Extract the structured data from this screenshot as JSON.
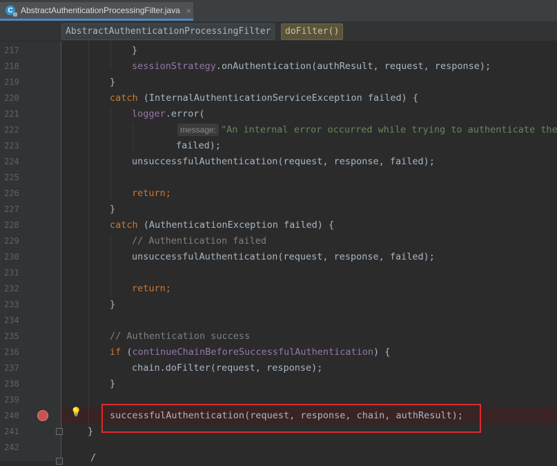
{
  "tab": {
    "label": "AbstractAuthenticationProcessingFilter.java",
    "close": "×",
    "icon": "java-class-icon"
  },
  "breadcrumb": {
    "class_name": "AbstractAuthenticationProcessingFilter",
    "method_name": "doFilter()"
  },
  "lines": [
    {
      "num": "217"
    },
    {
      "num": "218"
    },
    {
      "num": "219"
    },
    {
      "num": "220"
    },
    {
      "num": "221"
    },
    {
      "num": "222"
    },
    {
      "num": "223"
    },
    {
      "num": "224"
    },
    {
      "num": "225"
    },
    {
      "num": "226"
    },
    {
      "num": "227"
    },
    {
      "num": "228"
    },
    {
      "num": "229"
    },
    {
      "num": "230"
    },
    {
      "num": "231"
    },
    {
      "num": "232"
    },
    {
      "num": "233"
    },
    {
      "num": "234"
    },
    {
      "num": "235"
    },
    {
      "num": "236"
    },
    {
      "num": "237"
    },
    {
      "num": "238"
    },
    {
      "num": "239"
    },
    {
      "num": "240"
    },
    {
      "num": "241"
    },
    {
      "num": "242"
    }
  ],
  "code": {
    "l217": "}",
    "l218_field": "sessionStrategy",
    "l218_rest": ".onAuthentication(authResult, request, response);",
    "l219": "}",
    "l220_kw": "catch",
    "l220_rest": " (InternalAuthenticationServiceException failed) {",
    "l221_field": "logger",
    "l221_rest": ".error(",
    "l222_hint": "message:",
    "l222_str": "\"An internal error occurred while trying to authenticate the",
    "l223": "failed);",
    "l224": "unsuccessfulAuthentication(request, response, failed);",
    "l226_kw": "return;",
    "l227": "}",
    "l228_kw": "catch",
    "l228_rest": " (AuthenticationException failed) {",
    "l229": "// Authentication failed",
    "l230": "unsuccessfulAuthentication(request, response, failed);",
    "l232_kw": "return;",
    "l233": "}",
    "l235": "// Authentication success",
    "l236_kw": "if",
    "l236_field": "continueChainBeforeSuccessfulAuthentication",
    "l236_rest": ") {",
    "l237": "chain.doFilter(request, response);",
    "l238": "}",
    "l240": "successfulAuthentication(request, response, chain, authResult);",
    "l241": "}",
    "l242": "/"
  },
  "colors": {
    "background": "#2b2b2b",
    "keyword": "#cc7832",
    "field": "#9876aa",
    "comment": "#808080",
    "string": "#6a8759",
    "highlight_box": "#e02b2b",
    "breakpoint": "#c75450"
  }
}
